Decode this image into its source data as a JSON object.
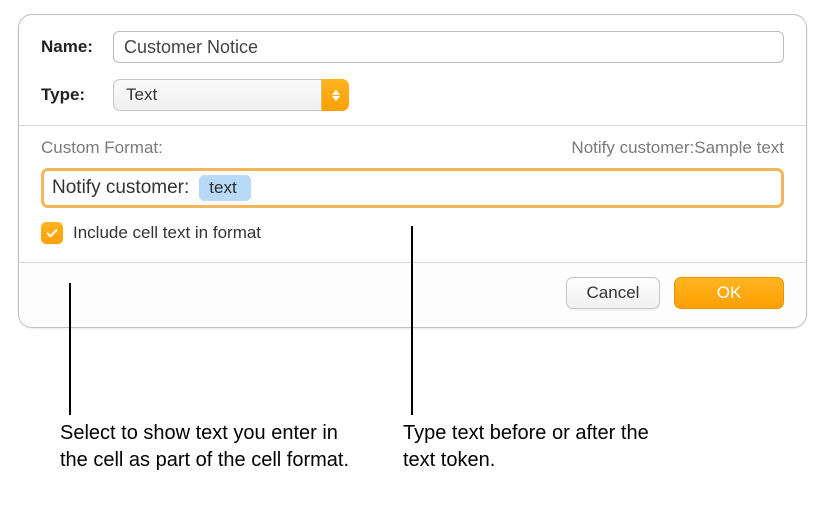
{
  "fields": {
    "name_label": "Name:",
    "name_value": "Customer Notice",
    "type_label": "Type:",
    "type_value": "Text"
  },
  "custom_format": {
    "heading": "Custom Format:",
    "preview": "Notify customer:Sample text",
    "prefix_text": "Notify customer: ",
    "token_label": "text"
  },
  "checkbox": {
    "label": "Include cell text in format",
    "checked": true
  },
  "buttons": {
    "cancel": "Cancel",
    "ok": "OK"
  },
  "callouts": {
    "left": "Select to show text you enter in the cell as part of the cell format.",
    "right": "Type text before or after the text token."
  }
}
